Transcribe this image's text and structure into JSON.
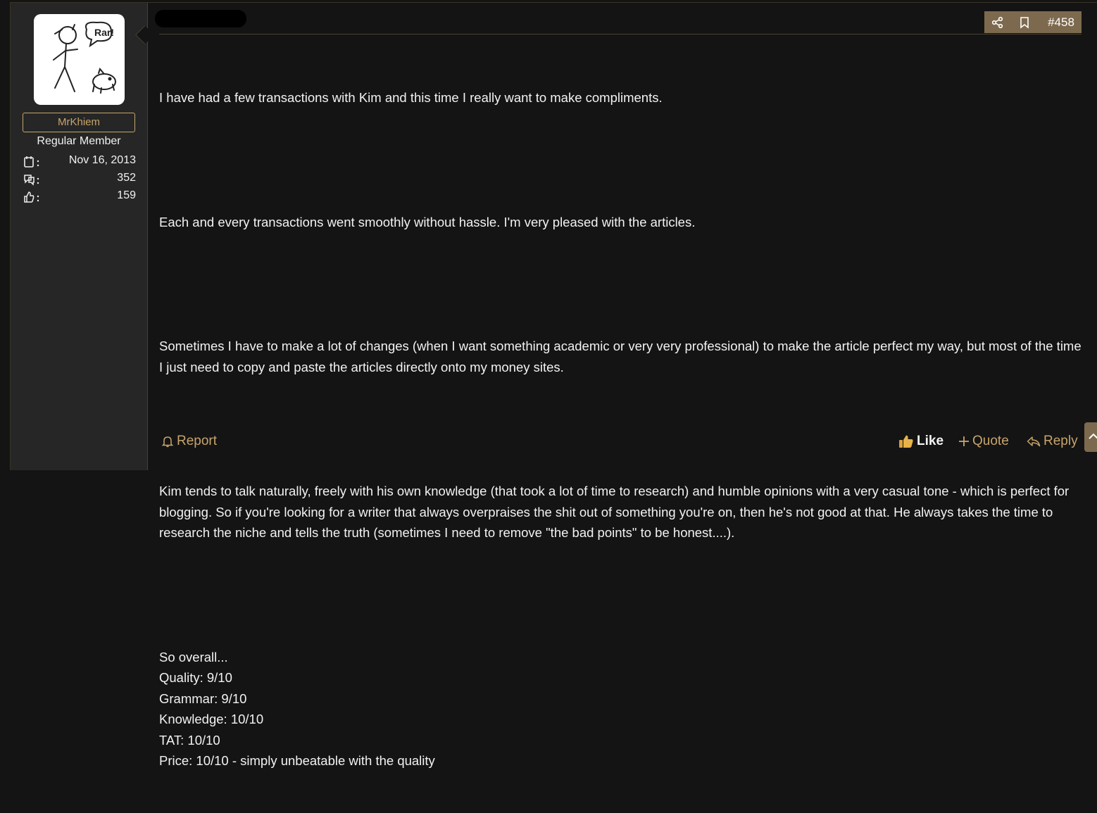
{
  "user": {
    "avatar_caption": "Rar!",
    "name": "MrKhiem",
    "role": "Regular Member",
    "stats": [
      {
        "icon": "calendar-icon",
        "value": "Nov 16, 2013"
      },
      {
        "icon": "messages-icon",
        "value": "352"
      },
      {
        "icon": "thumbs-up-icon",
        "value": "159"
      }
    ]
  },
  "post": {
    "number": "#458",
    "paragraphs": [
      "I have had a few transactions with Kim and this time I really want to make compliments.",
      "Each and every transactions went smoothly without hassle. I'm very pleased with the articles.",
      "Sometimes I have to make a lot of changes (when I want something academic or very very professional) to make the article perfect my way, but most of the time I just need to copy and paste the articles directly onto my money sites.",
      "Kim tends to talk naturally, freely with his own knowledge (that took a lot of time to research) and humble opinions with a very casual tone - which is perfect for blogging. So if you're looking for a writer that always overpraises the shit out of something you're on, then he's not good at that. He always takes the time to research the niche and tells the truth (sometimes I need to remove \"the bad points\" to be honest....).",
      "So overall...\nQuality: 9/10\nGrammar: 9/10\nKnowledge: 10/10\nTAT: 10/10\nPrice: 10/10 - simply unbeatable with the quality"
    ]
  },
  "actions": {
    "report": "Report",
    "like": "Like",
    "quote": "Quote",
    "reply": "Reply"
  },
  "colors": {
    "accent": "#c8a46a",
    "toolbar_bg": "#7d6a4e",
    "background": "#141414",
    "sidebar_bg": "#262626"
  }
}
